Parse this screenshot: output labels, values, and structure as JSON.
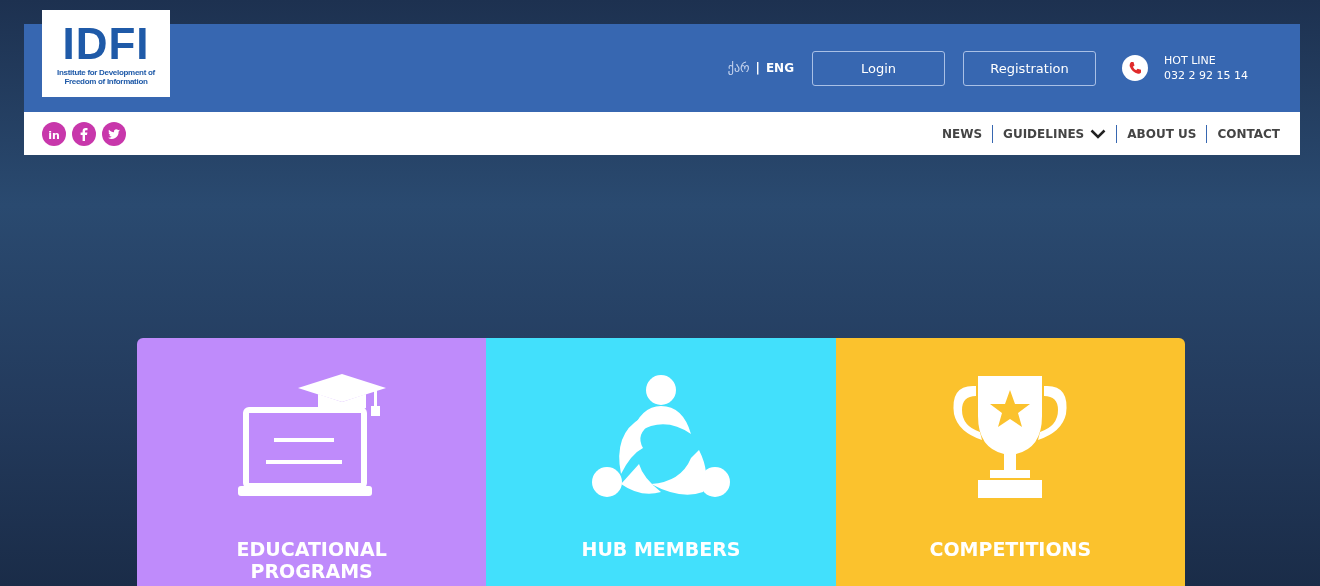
{
  "logo": {
    "mark": "IDFI",
    "subtitle": "Institute for Development of Freedom of Information"
  },
  "languages": [
    {
      "label": "ქარ",
      "selected": false
    },
    {
      "label": "ENG",
      "selected": true
    }
  ],
  "language_separator": "|",
  "buttons": [
    "Login",
    "Registration"
  ],
  "hotline": {
    "title": "HOT LINE",
    "number": "032 2 92 15 14"
  },
  "social": [
    {
      "kind": "linkedin",
      "label": "in"
    },
    {
      "kind": "facebook"
    },
    {
      "kind": "twitter"
    }
  ],
  "nav": [
    {
      "label": "NEWS",
      "kind": "link"
    },
    {
      "label": "GUIDELINES",
      "kind": "dropdown"
    },
    {
      "label": "ABOUT US",
      "kind": "link"
    },
    {
      "label": "CONTACT",
      "kind": "link"
    }
  ],
  "cards": [
    {
      "title": "EDUCATIONAL PROGRAMS",
      "kind": "education",
      "color": "#bf8bfb"
    },
    {
      "title": "HUB MEMBERS",
      "kind": "members",
      "color": "#42e0fc"
    },
    {
      "title": "COMPETITIONS",
      "kind": "trophy",
      "color": "#fbc22d"
    }
  ]
}
